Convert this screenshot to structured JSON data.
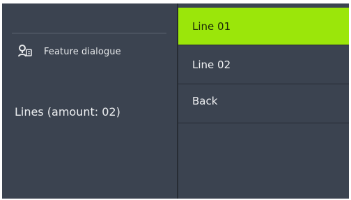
{
  "left_panel": {
    "feature_label": "Feature dialogue",
    "feature_icon": "feature-dialogue-icon",
    "lines_label": "Lines (amount: 02)"
  },
  "menu": {
    "items": [
      {
        "label": "Line 01",
        "selected": true
      },
      {
        "label": "Line 02",
        "selected": false
      },
      {
        "label": "Back",
        "selected": false
      }
    ]
  },
  "colors": {
    "background": "#3b4350",
    "selected": "#9be60a",
    "separator": "#262b33",
    "text": "#eceef0"
  }
}
